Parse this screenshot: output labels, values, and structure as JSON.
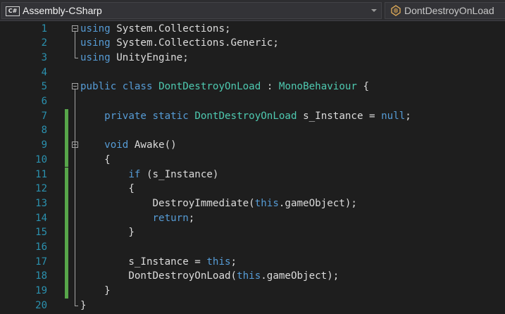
{
  "navigation_bar": {
    "project_badge": "C#",
    "project": "Assembly-CSharp",
    "type": "DontDestroyOnLoad",
    "type_icon": "class-icon"
  },
  "code_lines": [
    {
      "number": "1",
      "tokens": [
        {
          "t": "using",
          "c": "kw"
        },
        {
          "t": " System.Collections;",
          "c": "pl"
        }
      ]
    },
    {
      "number": "2",
      "tokens": [
        {
          "t": "using",
          "c": "kw"
        },
        {
          "t": " System.Collections.Generic;",
          "c": "pl"
        }
      ]
    },
    {
      "number": "3",
      "tokens": [
        {
          "t": "using",
          "c": "kw"
        },
        {
          "t": " UnityEngine;",
          "c": "pl"
        }
      ]
    },
    {
      "number": "4",
      "tokens": []
    },
    {
      "number": "5",
      "tokens": [
        {
          "t": "public",
          "c": "kw"
        },
        {
          "t": " ",
          "c": "pl"
        },
        {
          "t": "class",
          "c": "kw"
        },
        {
          "t": " ",
          "c": "pl"
        },
        {
          "t": "DontDestroyOnLoad",
          "c": "ty"
        },
        {
          "t": " : ",
          "c": "pl"
        },
        {
          "t": "MonoBehaviour",
          "c": "ty"
        },
        {
          "t": " {",
          "c": "pl"
        }
      ]
    },
    {
      "number": "6",
      "tokens": []
    },
    {
      "number": "7",
      "tokens": [
        {
          "t": "    ",
          "c": "pl"
        },
        {
          "t": "private",
          "c": "kw"
        },
        {
          "t": " ",
          "c": "pl"
        },
        {
          "t": "static",
          "c": "kw"
        },
        {
          "t": " ",
          "c": "pl"
        },
        {
          "t": "DontDestroyOnLoad",
          "c": "ty"
        },
        {
          "t": " s_Instance = ",
          "c": "pl"
        },
        {
          "t": "null",
          "c": "kw"
        },
        {
          "t": ";",
          "c": "pl"
        }
      ]
    },
    {
      "number": "8",
      "tokens": []
    },
    {
      "number": "9",
      "tokens": [
        {
          "t": "    ",
          "c": "pl"
        },
        {
          "t": "void",
          "c": "kw"
        },
        {
          "t": " Awake()",
          "c": "pl"
        }
      ]
    },
    {
      "number": "10",
      "tokens": [
        {
          "t": "    {",
          "c": "pl"
        }
      ]
    },
    {
      "number": "11",
      "tokens": [
        {
          "t": "        ",
          "c": "pl"
        },
        {
          "t": "if",
          "c": "kw"
        },
        {
          "t": " (s_Instance)",
          "c": "pl"
        }
      ]
    },
    {
      "number": "12",
      "tokens": [
        {
          "t": "        {",
          "c": "pl"
        }
      ]
    },
    {
      "number": "13",
      "tokens": [
        {
          "t": "            DestroyImmediate(",
          "c": "pl"
        },
        {
          "t": "this",
          "c": "kw"
        },
        {
          "t": ".gameObject);",
          "c": "pl"
        }
      ]
    },
    {
      "number": "14",
      "tokens": [
        {
          "t": "            ",
          "c": "pl"
        },
        {
          "t": "return",
          "c": "kw"
        },
        {
          "t": ";",
          "c": "pl"
        }
      ]
    },
    {
      "number": "15",
      "tokens": [
        {
          "t": "        }",
          "c": "pl"
        }
      ]
    },
    {
      "number": "16",
      "tokens": []
    },
    {
      "number": "17",
      "tokens": [
        {
          "t": "        s_Instance = ",
          "c": "pl"
        },
        {
          "t": "this",
          "c": "kw"
        },
        {
          "t": ";",
          "c": "pl"
        }
      ]
    },
    {
      "number": "18",
      "tokens": [
        {
          "t": "        DontDestroyOnLoad(",
          "c": "pl"
        },
        {
          "t": "this",
          "c": "kw"
        },
        {
          "t": ".gameObject);",
          "c": "pl"
        }
      ]
    },
    {
      "number": "19",
      "tokens": [
        {
          "t": "    }",
          "c": "pl"
        }
      ]
    },
    {
      "number": "20",
      "tokens": [
        {
          "t": "}",
          "c": "pl"
        }
      ]
    }
  ],
  "colors": {
    "keyword": "#569cd6",
    "type": "#4ec9b0",
    "line_number": "#2b91af",
    "change_marker": "#57a64a",
    "text": "#dcdcdc",
    "background": "#1e1e1e"
  }
}
